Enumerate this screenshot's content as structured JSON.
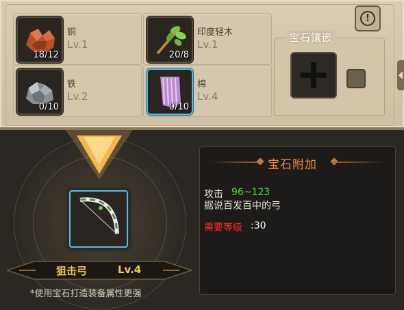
{
  "materials": [
    {
      "name": "铜",
      "level": "Lv.1",
      "count": "18/12",
      "icon": "copper-ore-icon"
    },
    {
      "name": "印度轻木",
      "level": "Lv.1",
      "count": "20/8",
      "icon": "wood-branch-icon"
    },
    {
      "name": "铁",
      "level": "Lv.2",
      "count": "0/10",
      "icon": "iron-ore-icon"
    },
    {
      "name": "棉",
      "level": "Lv.4",
      "count": "0/10",
      "icon": "cotton-cloth-icon"
    }
  ],
  "gem_inlay": {
    "title": "宝石镶嵌"
  },
  "weapon": {
    "name": "狙击弓",
    "level": "Lv.4",
    "icon": "bow-icon"
  },
  "hint": "*使用宝石打造装备属性更强",
  "info": {
    "title": "宝石附加",
    "stat_label": "攻击",
    "stat_value": "96~123",
    "description": "据说百发百中的弓",
    "req_label": "需要等级",
    "req_sep": ":",
    "req_value": "30"
  },
  "colors": {
    "accent": "#f08a3e",
    "stat_green": "#4cd82c",
    "required_red": "#ff2a2a",
    "item_gold": "#f1c84b",
    "selected_blue": "#5fb8e0"
  }
}
